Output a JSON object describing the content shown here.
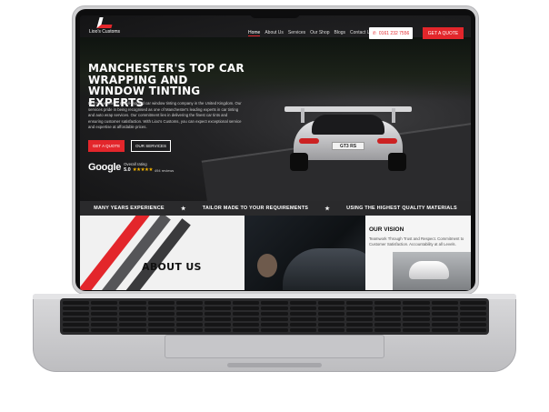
{
  "site": {
    "logo_text": "Lioo's Customs",
    "nav": [
      "Home",
      "About Us",
      "Services",
      "Our Shop",
      "Blogs",
      "Contact Us"
    ],
    "phone": "0161 232 7556",
    "phone_icon": "phone-icon",
    "quote_top": "GET A QUOTE"
  },
  "hero": {
    "headline": "MANCHESTER'S TOP CAR WRAPPING AND WINDOW TINTING EXPERTS",
    "description": "Lioo's Customs is a well-reputed car window tinting company in the United Kingdom. Our services pride in being recognised as one of Manchester's leading experts in car tinting and auto wrap services. Our commitment lies in delivering the finest car tints and ensuring customer satisfaction. With Lioo's Customs, you can expect exceptional service and expertise at affordable prices.",
    "cta_primary": "GET A QUOTE",
    "cta_secondary": "OUR SERVICES",
    "plate": "GT3 RS"
  },
  "rating": {
    "brand": "Google",
    "label": "Overall rating",
    "score": "5.0",
    "stars": "★★★★★",
    "reviews": "494 reviews"
  },
  "strip": {
    "items": [
      "MANY YEARS EXPERIENCE",
      "TAILOR MADE TO YOUR REQUIREMENTS",
      "USING THE HIGHEST QUALITY MATERIALS"
    ],
    "separator": "★"
  },
  "about": {
    "title": "ABOUT US"
  },
  "vision": {
    "title": "OUR VISION",
    "text": "Teamwork Through Trust and Respect. Commitment to Customer Satisfaction. Accountability at all Levels."
  },
  "colors": {
    "accent": "#e3262b",
    "dark": "#141415",
    "strip": "#2a2a2c"
  }
}
